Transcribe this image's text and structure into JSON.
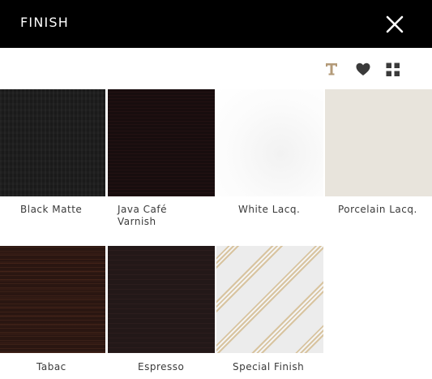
{
  "header": {
    "title": "FINISH",
    "close_icon": "close-icon"
  },
  "toolbar": {
    "icons": [
      "text-icon",
      "heart-icon",
      "grid-icon"
    ],
    "accent_color": "#b39a78"
  },
  "swatches": [
    {
      "label_line1": "Black Matte",
      "label_line2": ""
    },
    {
      "label_line1": "Java Café",
      "label_line2": "Varnish"
    },
    {
      "label_line1": "White Lacq.",
      "label_line2": ""
    },
    {
      "label_line1": "Porcelain Lacq.",
      "label_line2": ""
    },
    {
      "label_line1": "Tabac",
      "label_line2": ""
    },
    {
      "label_line1": "Espresso",
      "label_line2": ""
    },
    {
      "label_line1": "Special Finish",
      "label_line2": ""
    }
  ]
}
